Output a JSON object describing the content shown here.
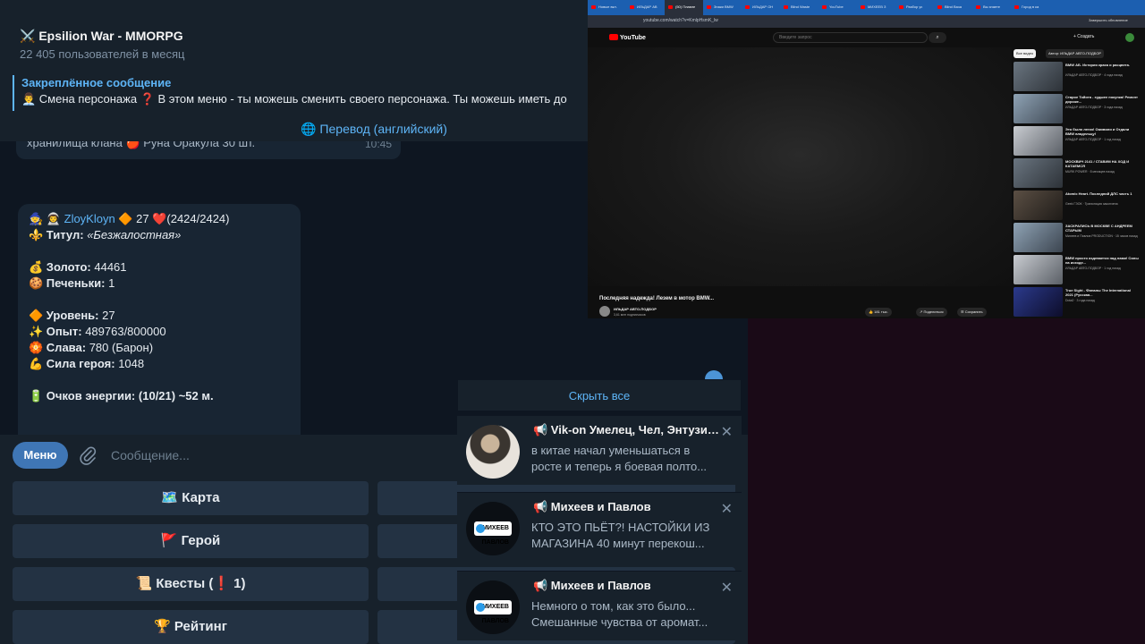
{
  "telegram": {
    "title": "⚔️ Epsilion War - MMORPG",
    "subtitle": "22 405 пользователей в месяц",
    "pinned": {
      "title": "Закреплённое сообщение",
      "text": "👨‍💼 Смена персонажа ❓ В этом меню - ты можешь сменить своего персонажа. Ты можешь иметь до"
    },
    "translate": "🌐 Перевод (английский)",
    "prev_message": {
      "text": "хранилища клана 🍎 Руна Оракула 30 шт.",
      "time": "10:45"
    },
    "message": {
      "line1_prefix": "🧙 👨‍🚀",
      "username": "ZloyKloyn",
      "line1_suffix": "🔶 27 ❤️(2424/2424)",
      "title_label": "⚜️ Титул:",
      "title_value": "«Безжалостная»",
      "gold_label": "💰 Золото:",
      "gold_value": "44461",
      "cookies_label": "🍪 Печеньки:",
      "cookies_value": "1",
      "level_label": "🔶 Уровень:",
      "level_value": "27",
      "exp_label": "✨ Опыт:",
      "exp_value": "489763/800000",
      "glory_label": "🏵️ Слава:",
      "glory_value": "780 (Барон)",
      "power_label": "💪 Сила героя:",
      "power_value": "1048",
      "energy_label": "🔋 Очков энергии:",
      "energy_value": "(10/21) ~52 м."
    },
    "menu_button": "Меню",
    "input_placeholder": "Сообщение...",
    "keyboard": [
      "🗺️ Карта",
      "🚩 Герой",
      "📜 Квесты (❗ 1)",
      "🏆 Рейтинг"
    ]
  },
  "notifications": {
    "hide_all": "Скрыть все",
    "items": [
      {
        "title": "📢 Vik-on Умелец, Чел, Энтузиаст",
        "line1": "в китае начал уменьшаться в",
        "line2": "росте и теперь я боевая полто..."
      },
      {
        "title": "📢 Михеев и Павлов",
        "line1": "КТО ЭТО ПЬЁТ?! НАСТОЙКИ ИЗ",
        "line2": "МАГАЗИНА  40 минут перекош...",
        "logo": "МИХЕЕВ ПАВЛОВ"
      },
      {
        "title": "📢 Михеев и Павлов",
        "line1": "Немного о том, как это было...",
        "line2": "Смешанные чувства от аромат...",
        "logo": "МИХЕЕВ ПАВЛОВ"
      }
    ]
  },
  "youtube": {
    "url": "youtube.com/watch?v=KmlpHsmK_lw",
    "account": "Завершить обновление",
    "search_placeholder": "Введите запрос",
    "create": "+ Создать",
    "logo": "YouTube",
    "video_title": "Последняя надежда! Лезем в мотор BMW...",
    "channel": "ИЛЬДАР АВТО-ПОДБОР",
    "subs": "3,61 млн подписчиков",
    "likes": "👍 181 тыс.",
    "share": "↗ Поделиться",
    "save": "☰ Сохранить",
    "chips": [
      "Все видео",
      "Автор: ИЛЬДАР АВТО-ПОДБОР"
    ],
    "sidebar": [
      {
        "title": "BMW АБ. История краха и расцвета.",
        "meta": "ИЛЬДАР АВТО-ПОДБОР · 4 года назад"
      },
      {
        "title": "Старое Тойота - худшее покупка! Ремонт дороже...",
        "meta": "ИЛЬДАР АВТО-ПОДБОР · 3 года назад"
      },
      {
        "title": "Это было легко! Оживили и Отдали BMW владельцу!",
        "meta": "ИЛЬДАР АВТО-ПОДБОР · 1 год назад"
      },
      {
        "title": "МОСКВИЧ 2141 / СТАВИМ НА ХОД И КАТАЕМСЯ",
        "meta": "MURK POWER · 8 месяцев назад"
      },
      {
        "title": "Atomic Heart. Последний ДЛС часть 1",
        "meta": "Geek ГЭОК · Трансляция закончена"
      },
      {
        "title": "ЗАСКРАЛИСЬ В МОСКВЕ С АНДРЕЕМ СТАРЫМ",
        "meta": "Михеев и Павлов PRODUCTION · 15 часов назад"
      },
      {
        "title": "BMW просто издевается над нами! Силы на исходе...",
        "meta": "ИЛЬДАР АВТО-ПОДБОР · 1 год назад"
      },
      {
        "title": "True Sight - Финалы The International 2021 (Русская...",
        "meta": "Dota2 · 3 года назад"
      }
    ],
    "tabs": [
      "Новые вкл.",
      "ИЛЬДАР АВ",
      "(50) Плавле",
      "Знаки BMW",
      "ИЛЬДАР ОН",
      "Blind Waste",
      "YouTube",
      "МИХЕЕВ З",
      "Разбор ус",
      "Blind Ваза",
      "Вы знаете",
      "Город в ка"
    ]
  }
}
